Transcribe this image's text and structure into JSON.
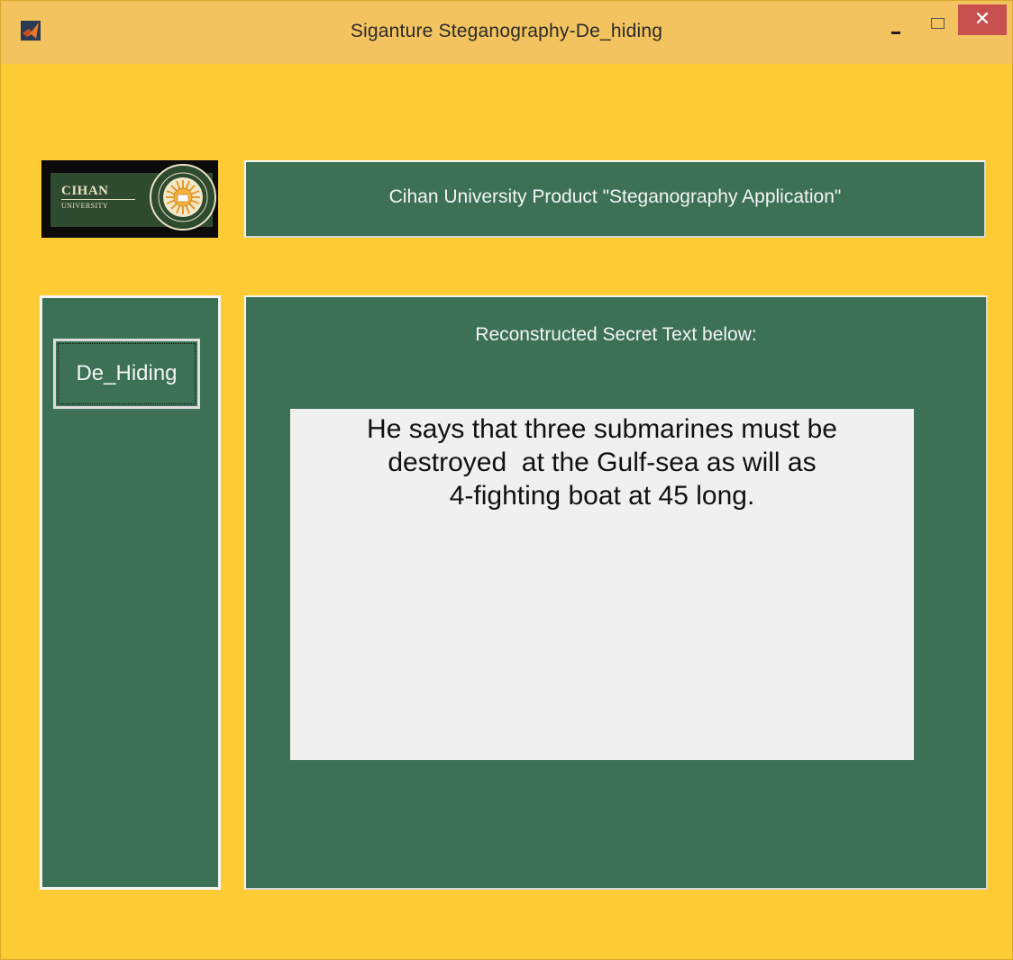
{
  "window": {
    "title": "Siganture Steganography-De_hiding",
    "close_glyph": "✕",
    "icon": "matlab-icon",
    "background_color": "#fdcb33"
  },
  "logo": {
    "wordmark": "CIHAN",
    "subtitle": "UNIVERSITY"
  },
  "banner": {
    "text": "Cihan University Product \"Steganography Application\"",
    "color": "#3c7156"
  },
  "sidebar": {
    "dehiding_button_label": "De_Hiding"
  },
  "main": {
    "heading": "Reconstructed Secret Text below:",
    "secret_text_lines": [
      "He says that three submarines must be",
      "destroyed  at the Gulf-sea as will as",
      "4-fighting boat at 45 long."
    ]
  }
}
